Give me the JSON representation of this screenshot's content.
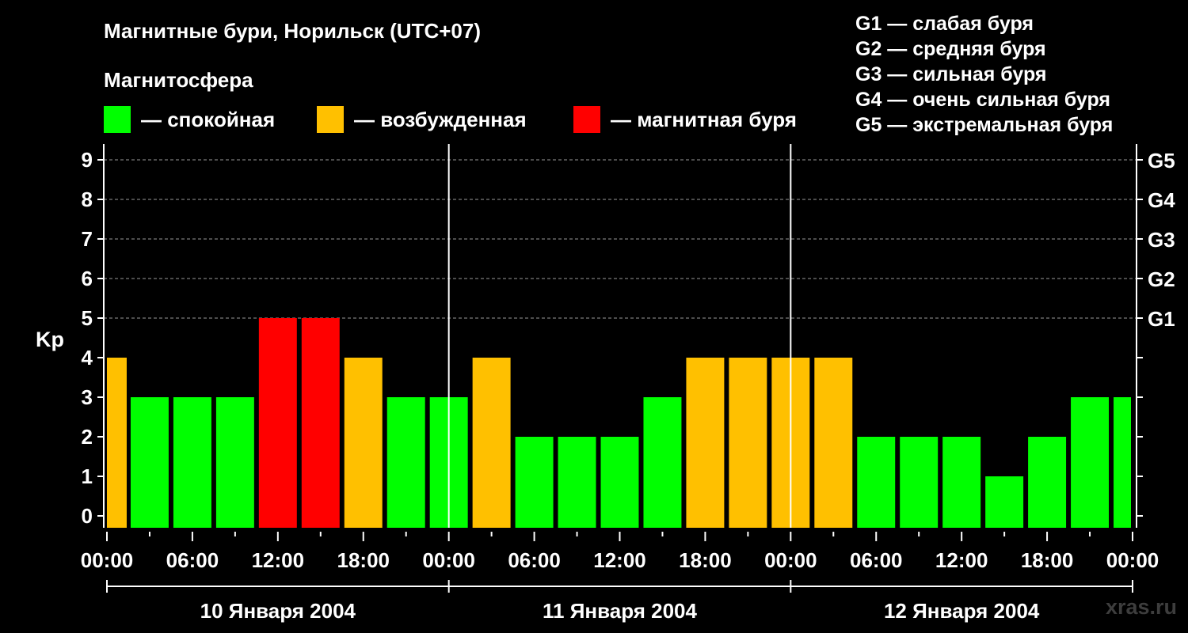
{
  "header": {
    "title": "Магнитные бури, Норильск (UTC+07)",
    "magnetosphere_label": "Магнитосфера"
  },
  "status_legend": [
    {
      "label": "— спокойная",
      "color": "#00ff00"
    },
    {
      "label": "— возбужденная",
      "color": "#ffc000"
    },
    {
      "label": "— магнитная буря",
      "color": "#ff0000"
    }
  ],
  "g_legend": [
    "G1 — слабая буря",
    "G2 — средняя буря",
    "G3 — сильная буря",
    "G4 — очень сильная буря",
    "G5 — экстремальная буря"
  ],
  "watermark": "xras.ru",
  "colors": {
    "quiet": "#00ff00",
    "active": "#ffc000",
    "storm": "#ff0000",
    "background": "#000000",
    "axis": "#ffffff"
  },
  "chart_data": {
    "type": "bar",
    "ylabel": "Kp",
    "ylim": [
      0,
      9
    ],
    "yticks": [
      "0",
      "1",
      "2",
      "3",
      "4",
      "5",
      "6",
      "7",
      "8",
      "9"
    ],
    "right_ticks": [
      {
        "kp": 5,
        "label": "G1"
      },
      {
        "kp": 6,
        "label": "G2"
      },
      {
        "kp": 7,
        "label": "G3"
      },
      {
        "kp": 8,
        "label": "G4"
      },
      {
        "kp": 9,
        "label": "G5"
      }
    ],
    "xticks": [
      "00:00",
      "06:00",
      "12:00",
      "18:00",
      "00:00",
      "06:00",
      "12:00",
      "18:00",
      "00:00",
      "06:00",
      "12:00",
      "18:00",
      "00:00"
    ],
    "days": [
      "10 Января 2004",
      "11 Января 2004",
      "12 Января 2004"
    ],
    "grid": true,
    "categories": [
      "10 Января 2004 00:00",
      "10 Января 2004 03:00",
      "10 Января 2004 06:00",
      "10 Января 2004 09:00",
      "10 Января 2004 12:00",
      "10 Января 2004 15:00",
      "10 Января 2004 18:00",
      "10 Января 2004 21:00",
      "11 Января 2004 00:00",
      "11 Января 2004 03:00",
      "11 Января 2004 06:00",
      "11 Января 2004 09:00",
      "11 Января 2004 12:00",
      "11 Января 2004 15:00",
      "11 Января 2004 18:00",
      "11 Января 2004 21:00",
      "12 Января 2004 00:00",
      "12 Января 2004 03:00",
      "12 Января 2004 06:00",
      "12 Января 2004 09:00",
      "12 Января 2004 12:00",
      "12 Января 2004 15:00",
      "12 Января 2004 18:00",
      "12 Января 2004 21:00"
    ],
    "values": [
      3,
      3,
      3,
      5,
      5,
      4,
      3,
      3,
      4,
      2,
      2,
      2,
      3,
      4,
      4,
      4,
      4,
      2,
      2,
      2,
      1,
      2,
      3,
      3
    ],
    "leading_value": 4
  }
}
